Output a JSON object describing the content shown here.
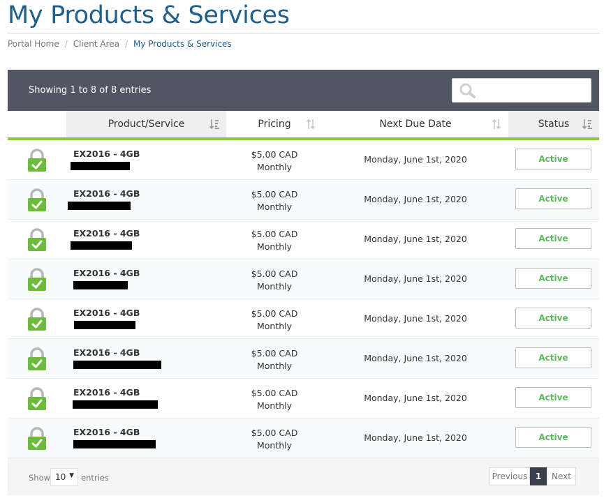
{
  "page": {
    "title": "My Products & Services"
  },
  "breadcrumb": [
    "Portal Home",
    "Client Area",
    "My Products & Services"
  ],
  "table": {
    "showing": "Showing 1 to 8 of 8 entries",
    "search_placeholder": "",
    "columns": [
      "Product/Service",
      "Pricing",
      "Next Due Date",
      "Status"
    ],
    "rows": [
      {
        "product": "EX2016 - 4GB",
        "price": "$5.00 CAD",
        "cycle": "Monthly",
        "due": "Monday, June 1st, 2020",
        "status": "Active"
      },
      {
        "product": "EX2016 - 4GB",
        "price": "$5.00 CAD",
        "cycle": "Monthly",
        "due": "Monday, June 1st, 2020",
        "status": "Active"
      },
      {
        "product": "EX2016 - 4GB",
        "price": "$5.00 CAD",
        "cycle": "Monthly",
        "due": "Monday, June 1st, 2020",
        "status": "Active"
      },
      {
        "product": "EX2016 - 4GB",
        "price": "$5.00 CAD",
        "cycle": "Monthly",
        "due": "Monday, June 1st, 2020",
        "status": "Active"
      },
      {
        "product": "EX2016 - 4GB",
        "price": "$5.00 CAD",
        "cycle": "Monthly",
        "due": "Monday, June 1st, 2020",
        "status": "Active"
      },
      {
        "product": "EX2016 - 4GB",
        "price": "$5.00 CAD",
        "cycle": "Monthly",
        "due": "Monday, June 1st, 2020",
        "status": "Active"
      },
      {
        "product": "EX2016 - 4GB",
        "price": "$5.00 CAD",
        "cycle": "Monthly",
        "due": "Monday, June 1st, 2020",
        "status": "Active"
      },
      {
        "product": "EX2016 - 4GB",
        "price": "$5.00 CAD",
        "cycle": "Monthly",
        "due": "Monday, June 1st, 2020",
        "status": "Active"
      }
    ]
  },
  "footer": {
    "show_label": "Show",
    "entries_value": "10",
    "entries_label": "entries",
    "prev": "Previous",
    "current_page": "1",
    "next": "Next"
  },
  "colors": {
    "title": "#1f5f8b",
    "accent_green": "#8cc63f",
    "header_bar": "#525664",
    "status_green": "#5cb85c"
  },
  "icons": [
    "search-icon",
    "sort-icon",
    "lock-check-icon",
    "caret-down-icon"
  ]
}
